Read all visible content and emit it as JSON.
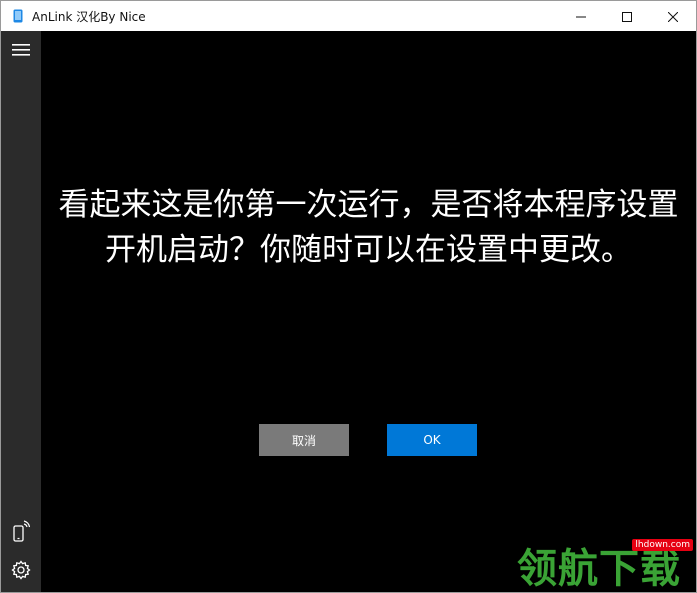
{
  "window": {
    "title": "AnLink 汉化By Nice",
    "app_icon": "phone-icon",
    "controls": [
      "minimize-icon",
      "maximize-icon",
      "close-icon"
    ]
  },
  "sidebar": {
    "top_icon": "hamburger-menu-icon",
    "bottom_icons": [
      "phone-cast-icon",
      "gear-icon"
    ]
  },
  "dialog": {
    "message_line1": "看起来这是你第一次运行，是否将本程序设置",
    "message_line2": "开机启动？你随时可以在设置中更改。",
    "cancel_label": "取消",
    "ok_label": "OK"
  },
  "watermark": {
    "url": "lhdown.com",
    "text": "领航下载"
  },
  "colors": {
    "background": "#000000",
    "sidebar": "#2b2b2b",
    "titlebar": "#ffffff",
    "accent": "#0078d7",
    "cancel": "#7a7a7a",
    "watermark_green": "#3aa335",
    "watermark_red": "#e60012"
  }
}
